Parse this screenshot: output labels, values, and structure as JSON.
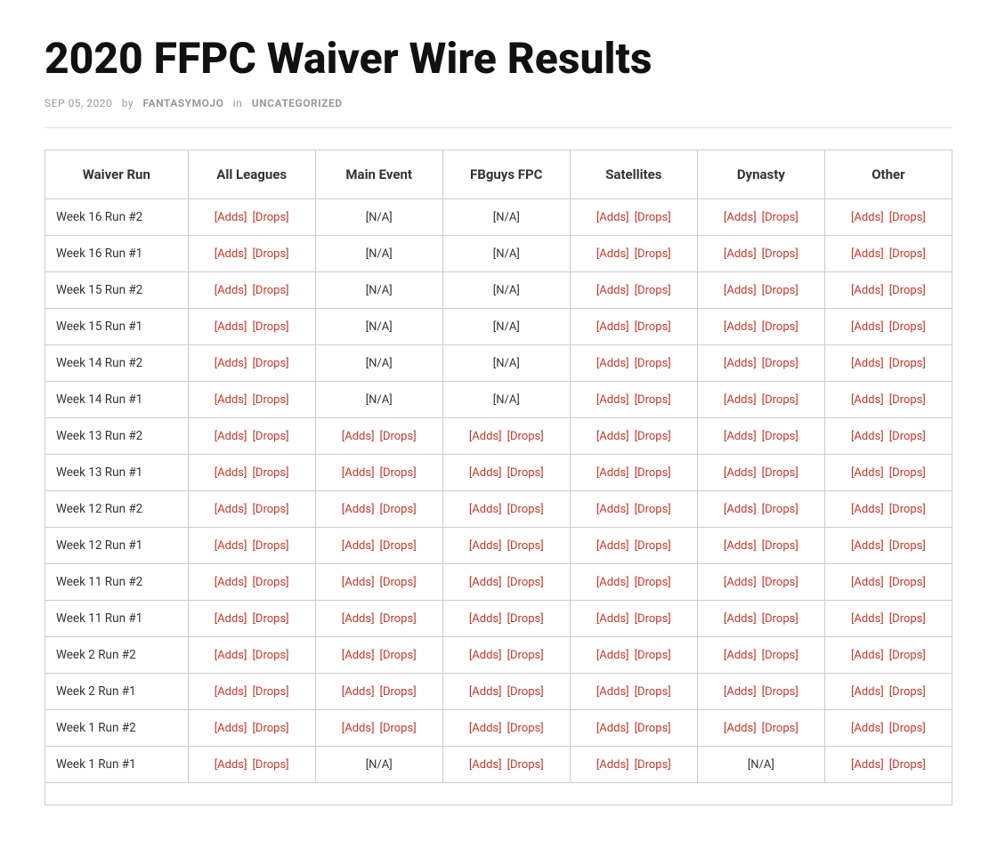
{
  "page": {
    "title": "2020 FFPC Waiver Wire Results",
    "meta": {
      "date": "SEP 05, 2020",
      "by": "by",
      "author": "FANTASYMOJO",
      "in": "in",
      "category": "UNCATEGORIZED"
    }
  },
  "table": {
    "headers": [
      "Waiver Run",
      "All Leagues",
      "Main Event",
      "FBguys FPC",
      "Satellites",
      "Dynasty",
      "Other"
    ],
    "rows": [
      {
        "label": "Week 16 Run #2",
        "all_leagues": {
          "adds": "[Adds]",
          "drops": "[Drops]",
          "na": false
        },
        "main_event": {
          "na": true
        },
        "fbguys": {
          "na": true
        },
        "satellites": {
          "adds": "[Adds]",
          "drops": "[Drops]",
          "na": false
        },
        "dynasty": {
          "adds": "[Adds]",
          "drops": "[Drops]",
          "na": false
        },
        "other": {
          "adds": "[Adds]",
          "drops": "[Drops]",
          "na": false
        }
      },
      {
        "label": "Week 16 Run #1",
        "all_leagues": {
          "adds": "[Adds]",
          "drops": "[Drops]",
          "na": false
        },
        "main_event": {
          "na": true
        },
        "fbguys": {
          "na": true
        },
        "satellites": {
          "adds": "[Adds]",
          "drops": "[Drops]",
          "na": false
        },
        "dynasty": {
          "adds": "[Adds]",
          "drops": "[Drops]",
          "na": false
        },
        "other": {
          "adds": "[Adds]",
          "drops": "[Drops]",
          "na": false
        }
      },
      {
        "label": "Week 15 Run #2",
        "all_leagues": {
          "adds": "[Adds]",
          "drops": "[Drops]",
          "na": false
        },
        "main_event": {
          "na": true
        },
        "fbguys": {
          "na": true
        },
        "satellites": {
          "adds": "[Adds]",
          "drops": "[Drops]",
          "na": false
        },
        "dynasty": {
          "adds": "[Adds]",
          "drops": "[Drops]",
          "na": false
        },
        "other": {
          "adds": "[Adds]",
          "drops": "[Drops]",
          "na": false
        }
      },
      {
        "label": "Week 15 Run #1",
        "all_leagues": {
          "adds": "[Adds]",
          "drops": "[Drops]",
          "na": false
        },
        "main_event": {
          "na": true
        },
        "fbguys": {
          "na": true
        },
        "satellites": {
          "adds": "[Adds]",
          "drops": "[Drops]",
          "na": false
        },
        "dynasty": {
          "adds": "[Adds]",
          "drops": "[Drops]",
          "na": false
        },
        "other": {
          "adds": "[Adds]",
          "drops": "[Drops]",
          "na": false
        }
      },
      {
        "label": "Week 14 Run #2",
        "all_leagues": {
          "adds": "[Adds]",
          "drops": "[Drops]",
          "na": false
        },
        "main_event": {
          "na": true
        },
        "fbguys": {
          "na": true
        },
        "satellites": {
          "adds": "[Adds]",
          "drops": "[Drops]",
          "na": false
        },
        "dynasty": {
          "adds": "[Adds]",
          "drops": "[Drops]",
          "na": false
        },
        "other": {
          "adds": "[Adds]",
          "drops": "[Drops]",
          "na": false
        }
      },
      {
        "label": "Week 14 Run #1",
        "all_leagues": {
          "adds": "[Adds]",
          "drops": "[Drops]",
          "na": false
        },
        "main_event": {
          "na": true
        },
        "fbguys": {
          "na": true
        },
        "satellites": {
          "adds": "[Adds]",
          "drops": "[Drops]",
          "na": false
        },
        "dynasty": {
          "adds": "[Adds]",
          "drops": "[Drops]",
          "na": false
        },
        "other": {
          "adds": "[Adds]",
          "drops": "[Drops]",
          "na": false
        }
      },
      {
        "label": "Week 13 Run #2",
        "all_leagues": {
          "adds": "[Adds]",
          "drops": "[Drops]",
          "na": false
        },
        "main_event": {
          "adds": "[Adds]",
          "drops": "[Drops]",
          "na": false
        },
        "fbguys": {
          "adds": "[Adds]",
          "drops": "[Drops]",
          "na": false
        },
        "satellites": {
          "adds": "[Adds]",
          "drops": "[Drops]",
          "na": false
        },
        "dynasty": {
          "adds": "[Adds]",
          "drops": "[Drops]",
          "na": false
        },
        "other": {
          "adds": "[Adds]",
          "drops": "[Drops]",
          "na": false
        }
      },
      {
        "label": "Week 13 Run #1",
        "all_leagues": {
          "adds": "[Adds]",
          "drops": "[Drops]",
          "na": false
        },
        "main_event": {
          "adds": "[Adds]",
          "drops": "[Drops]",
          "na": false
        },
        "fbguys": {
          "adds": "[Adds]",
          "drops": "[Drops]",
          "na": false
        },
        "satellites": {
          "adds": "[Adds]",
          "drops": "[Drops]",
          "na": false
        },
        "dynasty": {
          "adds": "[Adds]",
          "drops": "[Drops]",
          "na": false
        },
        "other": {
          "adds": "[Adds]",
          "drops": "[Drops]",
          "na": false
        }
      },
      {
        "label": "Week 12 Run #2",
        "all_leagues": {
          "adds": "[Adds]",
          "drops": "[Drops]",
          "na": false
        },
        "main_event": {
          "adds": "[Adds]",
          "drops": "[Drops]",
          "na": false
        },
        "fbguys": {
          "adds": "[Adds]",
          "drops": "[Drops]",
          "na": false
        },
        "satellites": {
          "adds": "[Adds]",
          "drops": "[Drops]",
          "na": false
        },
        "dynasty": {
          "adds": "[Adds]",
          "drops": "[Drops]",
          "na": false
        },
        "other": {
          "adds": "[Adds]",
          "drops": "[Drops]",
          "na": false
        }
      },
      {
        "label": "Week 12 Run #1",
        "all_leagues": {
          "adds": "[Adds]",
          "drops": "[Drops]",
          "na": false
        },
        "main_event": {
          "adds": "[Adds]",
          "drops": "[Drops]",
          "na": false
        },
        "fbguys": {
          "adds": "[Adds]",
          "drops": "[Drops]",
          "na": false
        },
        "satellites": {
          "adds": "[Adds]",
          "drops": "[Drops]",
          "na": false
        },
        "dynasty": {
          "adds": "[Adds]",
          "drops": "[Drops]",
          "na": false
        },
        "other": {
          "adds": "[Adds]",
          "drops": "[Drops]",
          "na": false
        }
      },
      {
        "label": "Week 11 Run #2",
        "all_leagues": {
          "adds": "[Adds]",
          "drops": "[Drops]",
          "na": false
        },
        "main_event": {
          "adds": "[Adds]",
          "drops": "[Drops]",
          "na": false
        },
        "fbguys": {
          "adds": "[Adds]",
          "drops": "[Drops]",
          "na": false
        },
        "satellites": {
          "adds": "[Adds]",
          "drops": "[Drops]",
          "na": false
        },
        "dynasty": {
          "adds": "[Adds]",
          "drops": "[Drops]",
          "na": false
        },
        "other": {
          "adds": "[Adds]",
          "drops": "[Drops]",
          "na": false
        }
      },
      {
        "label": "Week 11 Run #1",
        "all_leagues": {
          "adds": "[Adds]",
          "drops": "[Drops]",
          "na": false
        },
        "main_event": {
          "adds": "[Adds]",
          "drops": "[Drops]",
          "na": false
        },
        "fbguys": {
          "adds": "[Adds]",
          "drops": "[Drops]",
          "na": false
        },
        "satellites": {
          "adds": "[Adds]",
          "drops": "[Drops]",
          "na": false
        },
        "dynasty": {
          "adds": "[Adds]",
          "drops": "[Drops]",
          "na": false
        },
        "other": {
          "adds": "[Adds]",
          "drops": "[Drops]",
          "na": false
        }
      },
      {
        "label": "Week 2 Run #2",
        "all_leagues": {
          "adds": "[Adds]",
          "drops": "[Drops]",
          "na": false
        },
        "main_event": {
          "adds": "[Adds]",
          "drops": "[Drops]",
          "na": false
        },
        "fbguys": {
          "adds": "[Adds]",
          "drops": "[Drops]",
          "na": false
        },
        "satellites": {
          "adds": "[Adds]",
          "drops": "[Drops]",
          "na": false
        },
        "dynasty": {
          "adds": "[Adds]",
          "drops": "[Drops]",
          "na": false
        },
        "other": {
          "adds": "[Adds]",
          "drops": "[Drops]",
          "na": false
        }
      },
      {
        "label": "Week 2 Run #1",
        "all_leagues": {
          "adds": "[Adds]",
          "drops": "[Drops]",
          "na": false
        },
        "main_event": {
          "adds": "[Adds]",
          "drops": "[Drops]",
          "na": false
        },
        "fbguys": {
          "adds": "[Adds]",
          "drops": "[Drops]",
          "na": false
        },
        "satellites": {
          "adds": "[Adds]",
          "drops": "[Drops]",
          "na": false
        },
        "dynasty": {
          "adds": "[Adds]",
          "drops": "[Drops]",
          "na": false
        },
        "other": {
          "adds": "[Adds]",
          "drops": "[Drops]",
          "na": false
        }
      },
      {
        "label": "Week 1 Run #2",
        "all_leagues": {
          "adds": "[Adds]",
          "drops": "[Drops]",
          "na": false
        },
        "main_event": {
          "adds": "[Adds]",
          "drops": "[Drops]",
          "na": false
        },
        "fbguys": {
          "adds": "[Adds]",
          "drops": "[Drops]",
          "na": false
        },
        "satellites": {
          "adds": "[Adds]",
          "drops": "[Drops]",
          "na": false
        },
        "dynasty": {
          "adds": "[Adds]",
          "drops": "[Drops]",
          "na": false
        },
        "other": {
          "adds": "[Adds]",
          "drops": "[Drops]",
          "na": false
        }
      },
      {
        "label": "Week 1 Run #1",
        "all_leagues": {
          "adds": "[Adds]",
          "drops": "[Drops]",
          "na": false
        },
        "main_event": {
          "na": true
        },
        "fbguys": {
          "adds": "[Adds]",
          "drops": "[Drops]",
          "na": false
        },
        "satellites": {
          "adds": "[Adds]",
          "drops": "[Drops]",
          "na": false
        },
        "dynasty": {
          "na": true
        },
        "other": {
          "adds": "[Adds]",
          "drops": "[Drops]",
          "na": false
        }
      }
    ]
  }
}
